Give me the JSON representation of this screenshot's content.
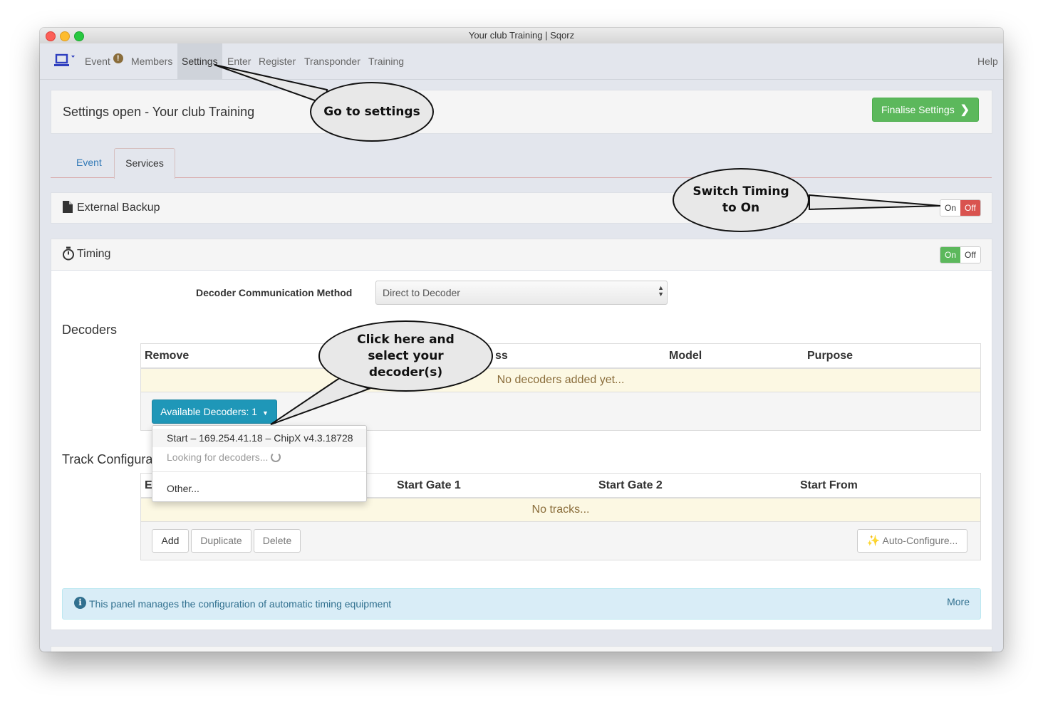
{
  "window": {
    "title": "Your club Training | Sqorz"
  },
  "nav": {
    "items": [
      "Event",
      "Members",
      "Settings",
      "Enter",
      "Register",
      "Transponder",
      "Training"
    ],
    "help": "Help"
  },
  "header": {
    "title": "Settings open - Your club Training",
    "finalise_label": "Finalise Settings"
  },
  "tabs": [
    "Event",
    "Services"
  ],
  "external_backup": {
    "title": "External Backup",
    "on": "On",
    "off": "Off"
  },
  "timing": {
    "title": "Timing",
    "on": "On",
    "off": "Off",
    "decoder_method_label": "Decoder Communication Method",
    "decoder_method_value": "Direct to Decoder",
    "decoders_title": "Decoders",
    "decoder_columns": [
      "Remove",
      "ss",
      "Model",
      "Purpose"
    ],
    "decoders_empty": "No decoders added yet...",
    "available_decoders_label": "Available Decoders: 1",
    "dropdown": {
      "item1": "Start – 169.254.41.18 – ChipX v4.3.18728",
      "item2": "Looking for decoders...",
      "item3": "Other..."
    },
    "track_title": "Track Configura",
    "track_columns": [
      "E",
      "Start Gate 1",
      "Start Gate 2",
      "Start From"
    ],
    "tracks_empty": "No tracks...",
    "buttons": {
      "add": "Add",
      "duplicate": "Duplicate",
      "delete": "Delete",
      "auto": "Auto-Configure..."
    },
    "info_text": "This panel manages the configuration of automatic timing equipment",
    "info_more": "More"
  },
  "callouts": {
    "settings": "Go to settings",
    "switch": "Switch Timing to On",
    "decoders": "Click here and select your decoder(s)"
  },
  "colors": {
    "green": "#5cb85c",
    "red": "#d9534f",
    "blue_btn": "#1f97b8",
    "link": "#337ab7",
    "warning_bg": "#fcf8e3",
    "info_bg": "#d9edf7"
  }
}
